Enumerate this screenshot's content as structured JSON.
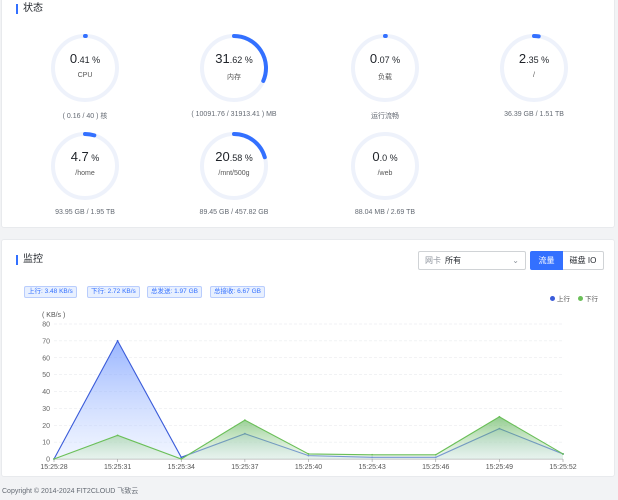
{
  "status": {
    "title": "状态",
    "gauges": [
      {
        "int": "0",
        "dec": ".41",
        "unit": " %",
        "name": "CPU",
        "sub": "( 0.16 / 40 ) 核",
        "percent": 0.41
      },
      {
        "int": "31",
        "dec": ".62",
        "unit": " %",
        "name": "内存",
        "sub": "( 10091.76 / 31913.41 ) MB",
        "percent": 31.62
      },
      {
        "int": "0",
        "dec": ".07",
        "unit": " %",
        "name": "负载",
        "sub": "运行流畅",
        "percent": 0.07
      },
      {
        "int": "2",
        "dec": ".35",
        "unit": " %",
        "name": "/",
        "sub": "36.39 GB / 1.51 TB",
        "percent": 2.35
      },
      {
        "int": "4.7",
        "dec": "",
        "unit": " %",
        "name": "/home",
        "sub": "93.95 GB / 1.95 TB",
        "percent": 4.7
      },
      {
        "int": "20",
        "dec": ".58",
        "unit": " %",
        "name": "/mnt/500g",
        "sub": "89.45 GB / 457.82 GB",
        "percent": 20.58
      },
      {
        "int": "0",
        "dec": ".0",
        "unit": " %",
        "name": "/web",
        "sub": "88.04 MB / 2.69 TB",
        "percent": 0.0
      }
    ]
  },
  "monitor": {
    "title": "监控",
    "nic_label": "网卡",
    "nic_value": "所有",
    "btn_traffic": "流量",
    "btn_disk_io": "磁盘 IO",
    "tags": {
      "up": "上行: 3.48 KB/s",
      "down": "下行: 2.72 KB/s",
      "sent": "总发送: 1.97 GB",
      "recv": "总接收: 6.67 GB"
    },
    "legend_up": "上行",
    "legend_down": "下行"
  },
  "colors": {
    "accent": "#3370ff",
    "up": "#3a5bd9",
    "down": "#6abf58"
  },
  "chart_data": {
    "type": "area",
    "ylabel": "( KB/s )",
    "ylim": [
      0,
      80
    ],
    "yticks": [
      0,
      10,
      20,
      30,
      40,
      50,
      60,
      70,
      80
    ],
    "x": [
      "15:25:28",
      "15:25:31",
      "15:25:34",
      "15:25:37",
      "15:25:40",
      "15:25:43",
      "15:25:46",
      "15:25:49",
      "15:25:52"
    ],
    "series": [
      {
        "name": "上行",
        "values": [
          0,
          70,
          1,
          15,
          2,
          1,
          1,
          18,
          3
        ]
      },
      {
        "name": "下行",
        "values": [
          0,
          14,
          0,
          23,
          3,
          2.5,
          2.5,
          25,
          3
        ]
      }
    ]
  },
  "footer": {
    "copyright": "Copyright © 2014-2024 FIT2CLOUD 飞致云"
  }
}
